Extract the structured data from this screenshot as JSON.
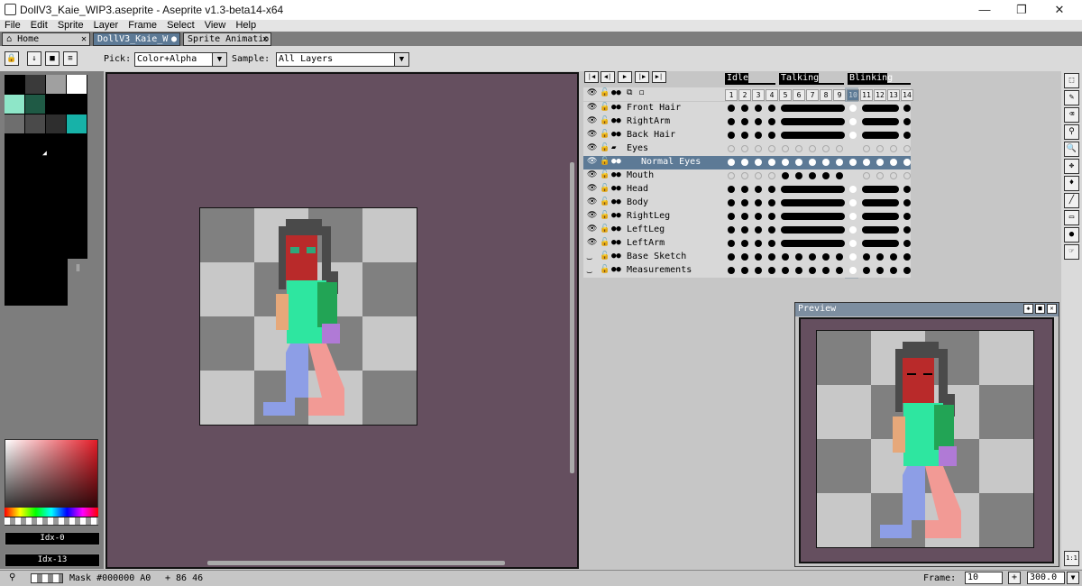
{
  "window": {
    "title": "DollV3_Kaie_WIP3.aseprite - Aseprite v1.3-beta14-x64",
    "minimize": "—",
    "maximize": "❐",
    "close": "✕"
  },
  "menu": [
    "File",
    "Edit",
    "Sprite",
    "Layer",
    "Frame",
    "Select",
    "View",
    "Help"
  ],
  "tabs": [
    {
      "label": "Home",
      "icon": "home-icon",
      "close": "✕"
    },
    {
      "label": "DollV3_Kaie_W",
      "active": true,
      "close": "●"
    },
    {
      "label": "Sprite Animatio",
      "close": "✕"
    }
  ],
  "toolbar": {
    "pick_label": "Pick:",
    "pick_value": "Color+Alpha",
    "sample_label": "Sample:",
    "sample_value": "All Layers"
  },
  "palette": {
    "colors": [
      "#000000",
      "#3a3a3a",
      "#a0a0a0",
      "#ffffff",
      "#8ee6c8",
      "#1f5a45",
      "#000000",
      "#000000",
      "#6e6e6e",
      "#4a4a4a",
      "#2e2e2e",
      "#17b2a8"
    ]
  },
  "color_bar": {
    "fg_index": "Idx-0",
    "bg_index": "Idx-13"
  },
  "timeline": {
    "tags": [
      {
        "name": "Idle"
      },
      {
        "name": "Talking"
      },
      {
        "name": "Blinking"
      }
    ],
    "frames": [
      "1",
      "2",
      "3",
      "4",
      "5",
      "6",
      "7",
      "8",
      "9",
      "10",
      "11",
      "12",
      "13",
      "14"
    ],
    "current_frame_index": 9,
    "layers": [
      {
        "name": "Front Hair",
        "cels": "x x x x L L L L L W L L L x"
      },
      {
        "name": "RightArm",
        "cels": "x x x x L L L L L W L L L x"
      },
      {
        "name": "Back Hair",
        "cels": "x x x x L L L L L W L L L x"
      },
      {
        "name": "Eyes",
        "group": true,
        "cels": "o o o o o o o o o C o o o o"
      },
      {
        "name": "Normal Eyes",
        "selected": true,
        "indent": true,
        "cels": "w w w w w w w w w w w w w w"
      },
      {
        "name": "Mouth",
        "cels": "o o o o x x x x x C o o o o"
      },
      {
        "name": "Head",
        "cels": "x x x x L L L L L W L L L x"
      },
      {
        "name": "Body",
        "cels": "x x x x L L L L L W L L L x"
      },
      {
        "name": "RightLeg",
        "cels": "x x x x L L L L L W L L L x"
      },
      {
        "name": "LeftLeg",
        "cels": "x x x x L L L L L W L L L x"
      },
      {
        "name": "LeftArm",
        "cels": "x x x x L L L L L W L L L x"
      },
      {
        "name": "Base Sketch",
        "hidden": true,
        "cels": "x x x x x x x x x W x x x x"
      },
      {
        "name": "Measurements",
        "hidden": true,
        "cels": "x x x x x x x x x W x x x x"
      }
    ]
  },
  "preview": {
    "title": "Preview"
  },
  "statusbar": {
    "mask": "Mask #000000 A0",
    "coords": "+ 86 46",
    "frame_label": "Frame:",
    "frame_value": "10",
    "add_frame": "+",
    "zoom": "300.0"
  },
  "colors": {
    "accent": "#5d7a96",
    "canvas_bg": "#654f5f"
  }
}
